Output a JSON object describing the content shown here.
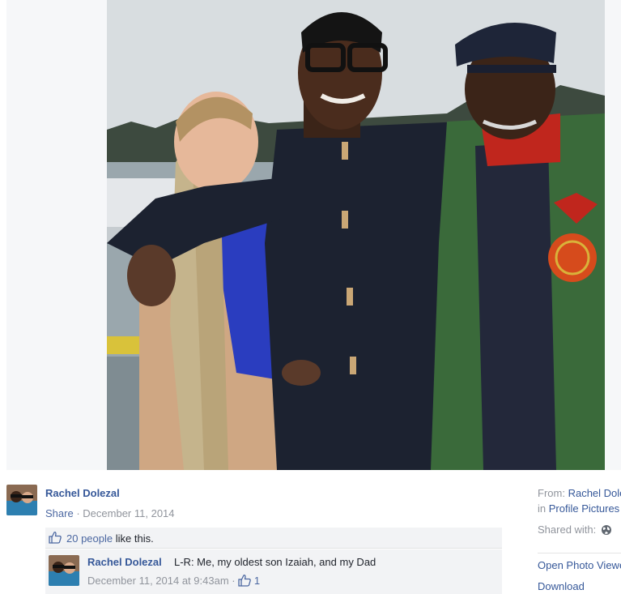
{
  "post": {
    "author": "Rachel Dolezal",
    "share_label": "Share",
    "separator": "·",
    "date": "December 11, 2014"
  },
  "likes": {
    "count_text": "20 people",
    "suffix": "like this."
  },
  "comment": {
    "author": "Rachel Dolezal",
    "text": "L-R: Me, my oldest son Izaiah, and my Dad",
    "timestamp": "December 11, 2014 at 9:43am",
    "separator": "·",
    "like_count": "1"
  },
  "sidebar": {
    "from_label": "From:",
    "from_value": "Rachel Dolezal",
    "in_label": "in",
    "album": "Profile Pictures",
    "shared_with_label": "Shared with:",
    "open_photo_viewer": "Open Photo Viewer",
    "download": "Download"
  },
  "icons": {
    "like": "thumbs-up-icon",
    "privacy": "globe-icon"
  },
  "colors": {
    "link": "#365899",
    "meta": "#90949c",
    "likes_bg": "#f2f3f5"
  }
}
